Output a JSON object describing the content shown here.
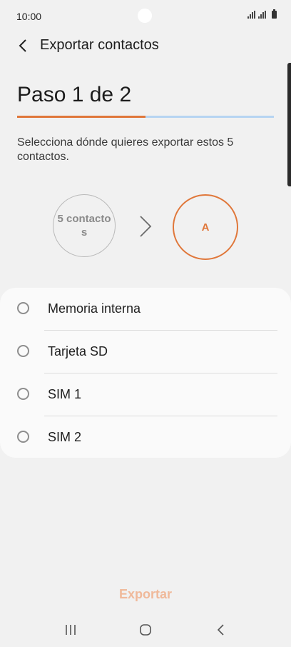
{
  "status_bar": {
    "time": "10:00"
  },
  "header": {
    "title": "Exportar contactos"
  },
  "step": {
    "title": "Paso 1 de 2",
    "progress_percent": 50
  },
  "description": "Selecciona dónde quieres exportar estos 5 contactos.",
  "flow": {
    "source_label": "5 contactos",
    "target_label": "A"
  },
  "options": [
    {
      "label": "Memoria interna",
      "selected": false
    },
    {
      "label": "Tarjeta SD",
      "selected": false
    },
    {
      "label": "SIM 1",
      "selected": false
    },
    {
      "label": "SIM 2",
      "selected": false
    }
  ],
  "actions": {
    "export_label": "Exportar"
  },
  "colors": {
    "accent": "#e0773a",
    "accent_disabled": "#f0b99a",
    "progress_track": "#b6d4f2",
    "background": "#f1f1f1",
    "card": "#fafafa"
  }
}
